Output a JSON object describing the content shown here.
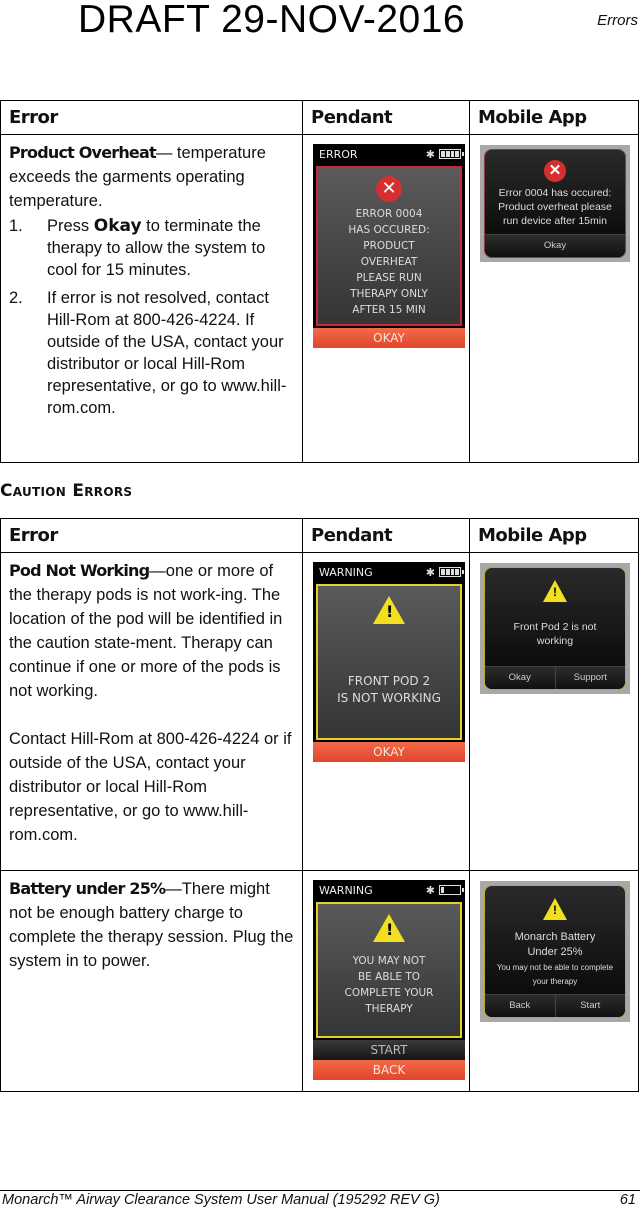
{
  "header": {
    "draft_stamp": "DRAFT 29-NOV-2016",
    "running_head": "Errors"
  },
  "table_headers": [
    "Error",
    "Pendant",
    "Mobile App"
  ],
  "error_table": {
    "rows": [
      {
        "title": "Product Overheat",
        "dash": "—",
        "intro": "temperature exceeds the garments  operating temperature.",
        "steps": [
          {
            "num": "1.",
            "pre": "Press ",
            "bold": "Okay",
            "post": " to terminate the therapy to allow the system to cool for 15 minutes."
          },
          {
            "num": "2.",
            "text": "If error is not resolved, contact Hill-Rom at 800-426-4224. If outside of the USA, contact your distributor or local  Hill-Rom representative, or go to www.hill-rom.com."
          }
        ],
        "pendant": {
          "status": "ERROR",
          "icon": "error-x-icon",
          "lines": [
            "ERROR 0004",
            "HAS OCCURED:",
            "PRODUCT",
            "OVERHEAT",
            "PLEASE RUN",
            "THERAPY ONLY",
            "AFTER 15 MIN"
          ],
          "button": "OKAY",
          "accent": "#c8283a"
        },
        "mobile": {
          "icon": "error-x-icon",
          "lines": [
            "Error 0004 has occured:",
            "Product overheat please",
            "run device after 15min"
          ],
          "buttons": [
            "Okay"
          ]
        }
      }
    ]
  },
  "caution_heading": "Caution Errors",
  "caution_table": {
    "rows": [
      {
        "title": "Pod Not Working",
        "dash": "—",
        "text": "one or more of the therapy pods is not work-ing. The location of the pod will be identified in the caution state-ment. Therapy can continue if one or more of the pods is not working.",
        "contact": "Contact Hill-Rom at 800-426-4224 or if outside of the USA, contact your distributor or local Hill-Rom representative, or go to www.hill-rom.com.",
        "pendant": {
          "status": "WARNING",
          "icon": "warning-triangle-icon",
          "lines": [
            "FRONT POD 2",
            "IS NOT WORKING"
          ],
          "buttons": [
            "OKAY"
          ],
          "accent": "#e6d020"
        },
        "mobile": {
          "icon": "warning-triangle-icon",
          "lines": [
            "Front Pod 2 is not",
            "working"
          ],
          "buttons": [
            "Okay",
            "Support"
          ]
        }
      },
      {
        "title": "Battery under 25%",
        "dash": "—",
        "text": "There might not be enough battery charge to complete the therapy session. Plug the system in to power.",
        "pendant": {
          "status": "WARNING",
          "icon": "warning-triangle-icon",
          "lines": [
            "YOU MAY NOT",
            "BE ABLE TO",
            "COMPLETE YOUR",
            "THERAPY"
          ],
          "buttons": [
            "START",
            "BACK"
          ],
          "battery": "low",
          "accent": "#e6d020"
        },
        "mobile": {
          "icon": "warning-triangle-icon",
          "lines": [
            "Monarch Battery",
            "Under 25%"
          ],
          "sub_lines": [
            "You may not be able to complete",
            "your therapy"
          ],
          "buttons": [
            "Back",
            "Start"
          ]
        }
      }
    ]
  },
  "footer": {
    "manual_title": "Monarch™ Airway Clearance System User Manual (195292 REV G)",
    "page_number": "61"
  }
}
